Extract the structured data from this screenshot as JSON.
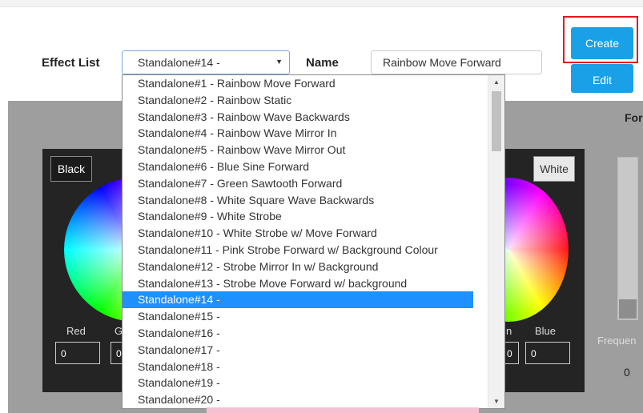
{
  "header": {
    "effect_list_label": "Effect List",
    "effect_list_value": "Standalone#14 -",
    "name_label": "Name",
    "name_value": "Rainbow Move Forward",
    "create_label": "Create",
    "edit_label": "Edit"
  },
  "colors": {
    "accent": "#1aa0e6",
    "highlight": "#e0191f",
    "selection": "#1e90ff"
  },
  "left_picker": {
    "swatch_label": "Black",
    "red_label": "Red",
    "green_partial": "G",
    "red_value": "0",
    "green_partial_value": "0"
  },
  "right_picker": {
    "swatch_label": "White",
    "green_partial": "n",
    "blue_label": "Blue",
    "blue_value": "0",
    "green_partial_value": "0"
  },
  "right_side": {
    "heading_partial": "For",
    "frequency_partial": "Frequen",
    "frequency_value": "0"
  },
  "dropdown": {
    "selected_index": 13,
    "options": [
      "Standalone#1 - Rainbow Move Forward",
      "Standalone#2 - Rainbow Static",
      "Standalone#3 - Rainbow Wave Backwards",
      "Standalone#4 - Rainbow Wave Mirror In",
      "Standalone#5 - Rainbow Wave Mirror Out",
      "Standalone#6 - Blue Sine Forward",
      "Standalone#7 - Green Sawtooth Forward",
      "Standalone#8 - White Square Wave Backwards",
      "Standalone#9 - White Strobe",
      "Standalone#10 - White Strobe w/ Move Forward",
      "Standalone#11 - Pink Strobe Forward w/ Background Colour",
      "Standalone#12 - Strobe Mirror In w/ Background",
      "Standalone#13 - Strobe Move Forward w/ background",
      "Standalone#14 -",
      "Standalone#15 -",
      "Standalone#16 -",
      "Standalone#17 -",
      "Standalone#18 -",
      "Standalone#19 -",
      "Standalone#20 -"
    ]
  }
}
